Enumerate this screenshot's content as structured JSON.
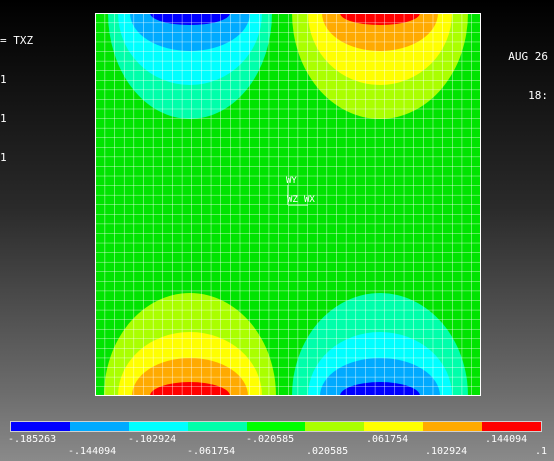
{
  "header": {
    "result_line": "= TXZ",
    "lines": [
      "1",
      "1",
      "1"
    ],
    "date": "AUG 26",
    "time": "18:"
  },
  "triad": {
    "y_label": "WY",
    "z_label": "WZ",
    "x_label": "WX"
  },
  "contour_legend": {
    "colors": [
      "#0000ff",
      "#00aaff",
      "#00ffff",
      "#00ffaa",
      "#00ff00",
      "#aaff00",
      "#ffff00",
      "#ffaa00",
      "#ff0000"
    ],
    "values_upper": [
      "-.185263",
      "-.102924",
      "-.020585",
      ".061754",
      ".144094"
    ],
    "values_lower": [
      "-.144094",
      "-.061754",
      ".020585",
      ".102924",
      ".1"
    ]
  },
  "plot_colors": {
    "background": "#00e400",
    "mesh": "#ffffff"
  }
}
